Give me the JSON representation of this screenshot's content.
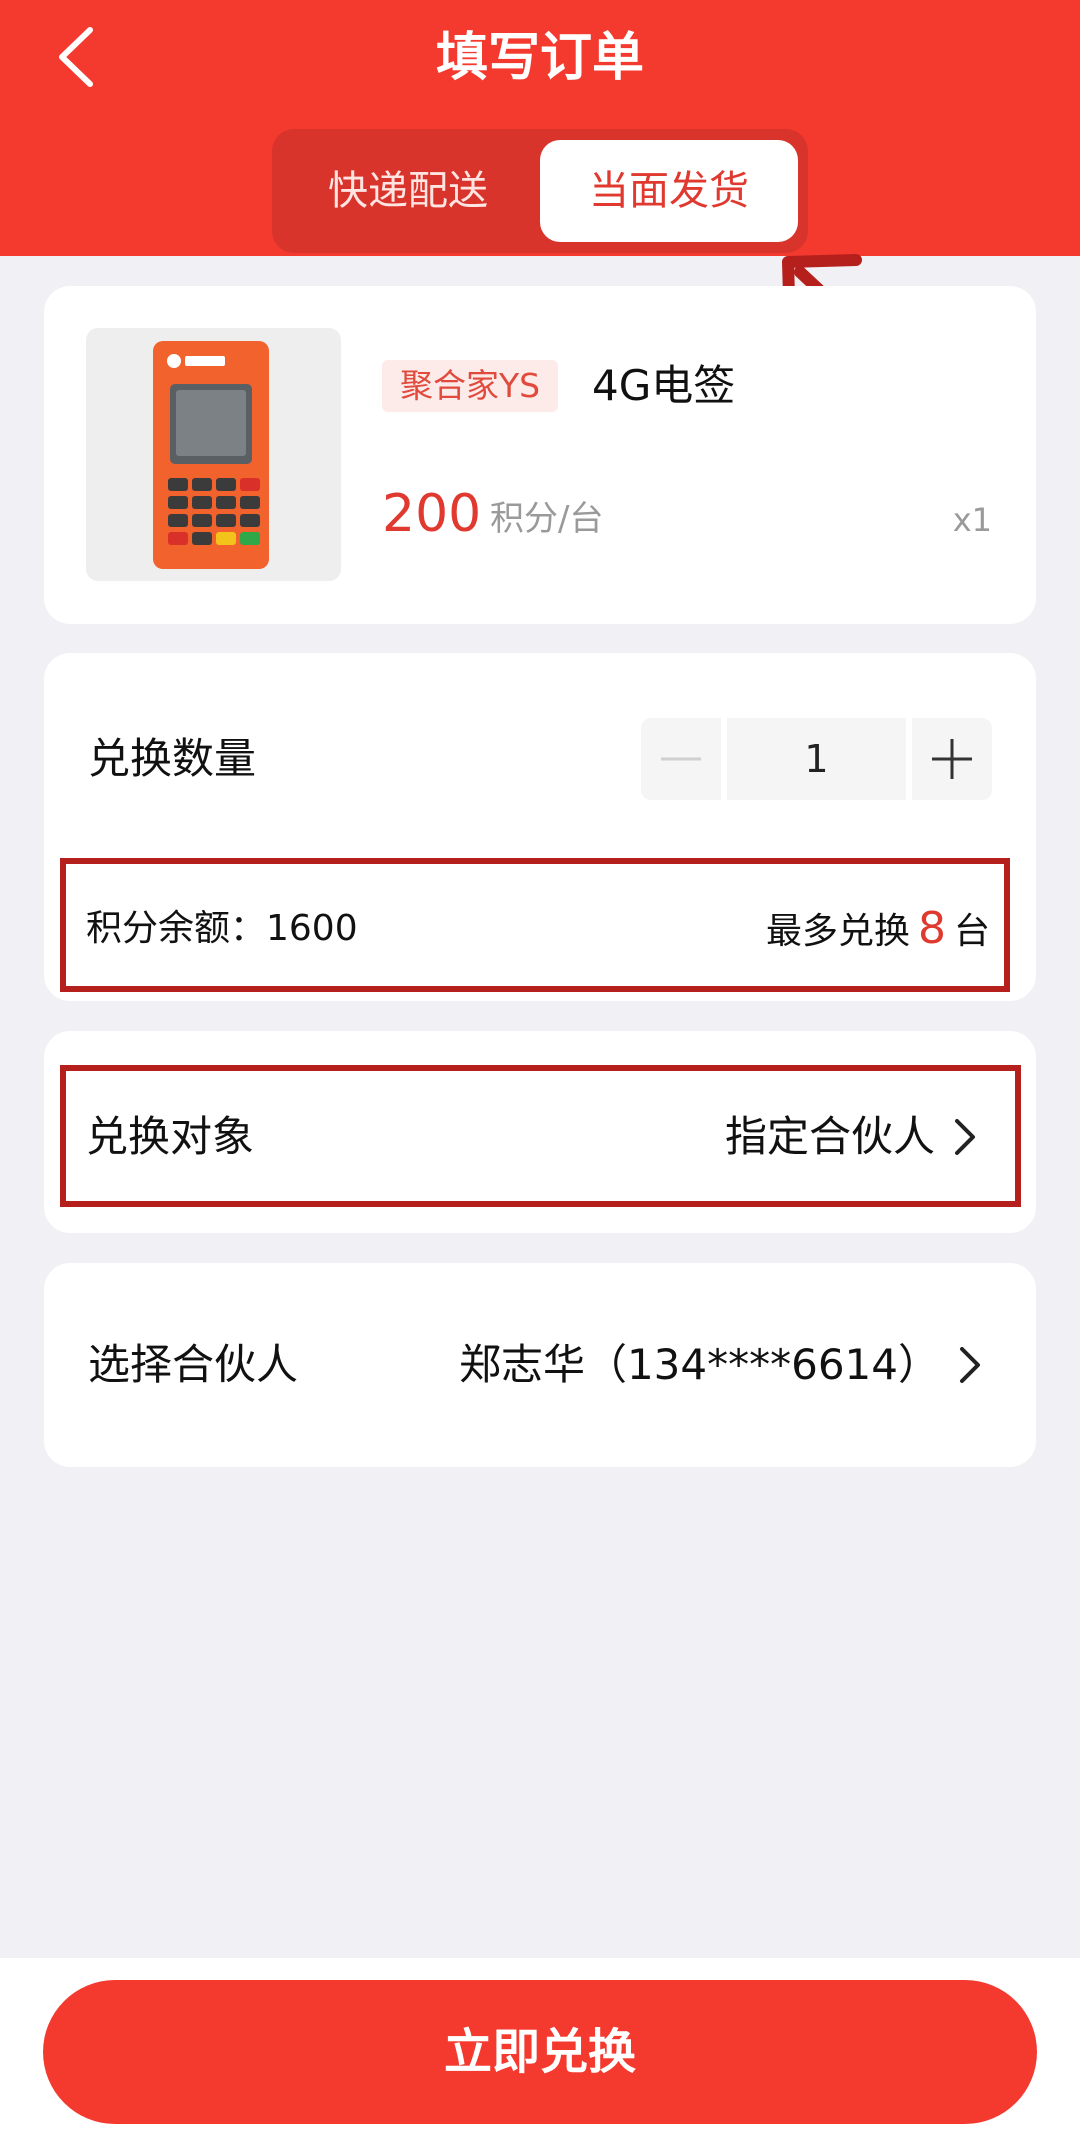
{
  "header": {
    "title": "填写订单",
    "tabs": [
      {
        "label": "快递配送",
        "active": false
      },
      {
        "label": "当面发货",
        "active": true
      }
    ],
    "color": "#f43a2f"
  },
  "product": {
    "image_icon": "pos-terminal-image",
    "brand_tag": "聚合家YS",
    "name": "4G电签",
    "price": "200",
    "price_unit": "积分/台",
    "quantity_tag": "x1"
  },
  "exchange": {
    "quantity_label": "兑换数量",
    "quantity_value": "1",
    "balance_text": "积分余额：1600",
    "max_prefix": "最多兑换",
    "max_value": "8",
    "max_suffix": "台"
  },
  "target": {
    "label": "兑换对象",
    "value": "指定合伙人"
  },
  "partner": {
    "label": "选择合伙人",
    "value": "郑志华（134****6614）"
  },
  "footer": {
    "submit_label": "立即兑换"
  },
  "colors": {
    "accent": "#f43a2f",
    "annotation": "#b5201c",
    "price": "#e0392f"
  }
}
